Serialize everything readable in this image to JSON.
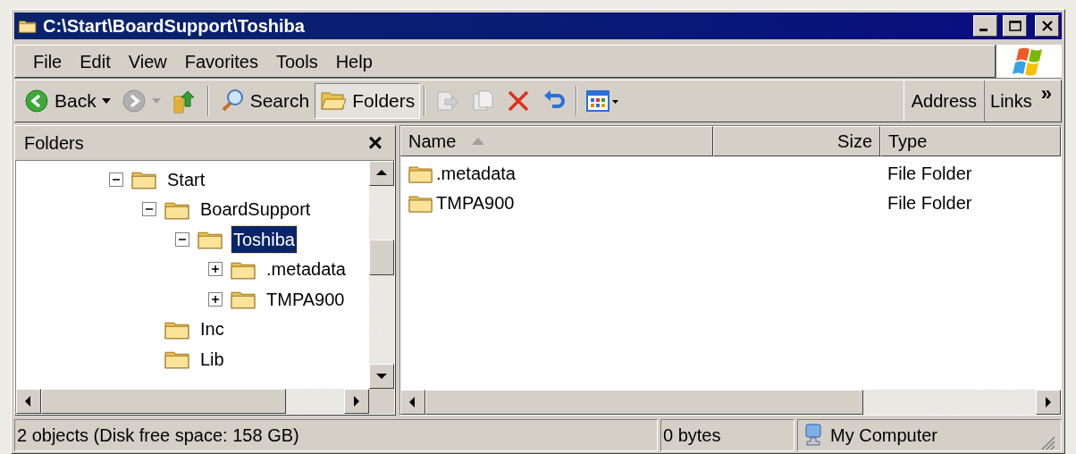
{
  "window": {
    "title": "C:\\Start\\BoardSupport\\Toshiba"
  },
  "menu": [
    "File",
    "Edit",
    "View",
    "Favorites",
    "Tools",
    "Help"
  ],
  "toolbar": {
    "buttons": [
      {
        "kind": "back",
        "label": "Back",
        "disabled": false,
        "selected": false
      },
      {
        "kind": "forward",
        "disabled": true,
        "selected": false
      },
      {
        "kind": "up",
        "disabled": false,
        "selected": false
      },
      {
        "kind": "separator"
      },
      {
        "kind": "search",
        "label": "Search",
        "disabled": false,
        "selected": false
      },
      {
        "kind": "folders",
        "label": "Folders",
        "disabled": false,
        "selected": true
      },
      {
        "kind": "separator"
      },
      {
        "kind": "move",
        "disabled": true,
        "selected": false
      },
      {
        "kind": "copy",
        "disabled": true,
        "selected": false
      },
      {
        "kind": "delete",
        "disabled": false,
        "selected": false
      },
      {
        "kind": "undo",
        "disabled": false,
        "selected": false
      },
      {
        "kind": "separator"
      },
      {
        "kind": "views",
        "disabled": false,
        "selected": false
      }
    ],
    "address_label": "Address",
    "links_label": "Links",
    "chevron": "»"
  },
  "folders_pane": {
    "title": "Folders",
    "close": "×",
    "tree": [
      {
        "label": "Start",
        "kind": "branch",
        "expanded": true,
        "selected": false,
        "children": [
          {
            "label": "BoardSupport",
            "kind": "branch",
            "expanded": true,
            "selected": false,
            "children": [
              {
                "label": "Toshiba",
                "kind": "branch",
                "expanded": true,
                "selected": true,
                "children": [
                  {
                    "label": ".metadata",
                    "kind": "branch",
                    "expanded": false,
                    "selected": false
                  },
                  {
                    "label": "TMPA900",
                    "kind": "branch",
                    "expanded": false,
                    "selected": false
                  }
                ]
              }
            ]
          },
          {
            "label": "Inc",
            "kind": "leaf",
            "selected": false
          },
          {
            "label": "Lib",
            "kind": "leaf",
            "selected": false
          }
        ]
      }
    ]
  },
  "file_list": {
    "columns": [
      {
        "label": "Name",
        "sorted": true
      },
      {
        "label": "Size"
      },
      {
        "label": "Type"
      }
    ],
    "rows": [
      {
        "name": ".metadata",
        "type": "File Folder"
      },
      {
        "name": "TMPA900",
        "type": "File Folder"
      }
    ]
  },
  "status_bar": {
    "summary": "2 objects (Disk free space: 158 GB)",
    "size": "0 bytes",
    "zone": "My Computer"
  }
}
